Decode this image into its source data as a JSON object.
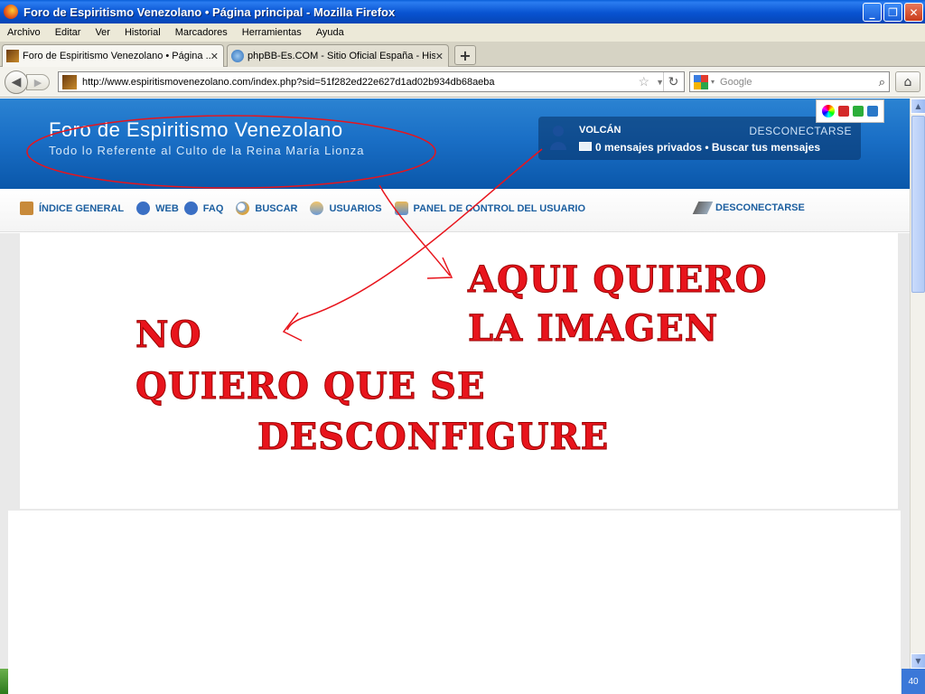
{
  "window": {
    "title": "Foro de Espiritismo Venezolano • Página principal - Mozilla Firefox"
  },
  "menu": [
    "Archivo",
    "Editar",
    "Ver",
    "Historial",
    "Marcadores",
    "Herramientas",
    "Ayuda"
  ],
  "tabs": [
    {
      "label": "Foro de Espiritismo Venezolano • Página ...",
      "active": true
    },
    {
      "label": "phpBB-Es.COM - Sitio Oficial España - His...",
      "active": false
    }
  ],
  "nav": {
    "url": "http://www.espiritismovenezolano.com/index.php?sid=51f282ed22e627d1ad02b934db68aeba",
    "search_placeholder": "Google"
  },
  "site": {
    "title": "Foro de Espiritismo Venezolano",
    "subtitle": "Todo lo Referente al Culto de la Reina María Lionza",
    "user": "VOLCÁN",
    "logout": "DESCONECTARSE",
    "messages": "0 mensajes privados • Buscar tus mensajes",
    "nav_items": [
      {
        "label": "ÍNDICE GENERAL",
        "icon": "home-icon"
      },
      {
        "label": "WEB",
        "icon": "info-icon"
      },
      {
        "label": "FAQ",
        "icon": "info-icon"
      },
      {
        "label": "BUSCAR",
        "icon": "search-icon"
      },
      {
        "label": "USUARIOS",
        "icon": "users-icon"
      },
      {
        "label": "PANEL DE CONTROL DEL USUARIO",
        "icon": "control-panel-icon"
      }
    ],
    "nav_right": "DESCONECTARSE",
    "swatch_colors": [
      "#d42a2a",
      "#2cae3a",
      "#2a78c8"
    ]
  },
  "annotations": {
    "aqui_line1": "AQUI QUIERO",
    "aqui_line2": "LA IMAGEN",
    "no_line1": "NO",
    "no_line2": "QUIERO QUE SE",
    "no_line3": "DESCONFIGURE",
    "color": "#e8141c"
  },
  "status": {
    "right": "40"
  }
}
